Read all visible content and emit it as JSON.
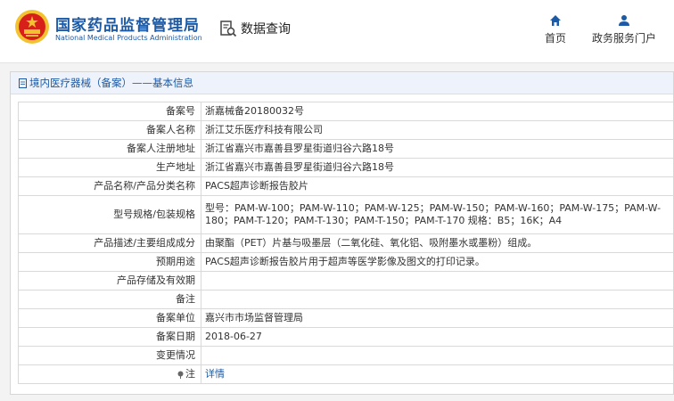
{
  "header": {
    "brand_cn": "国家药品监督管理局",
    "brand_en": "National Medical Products Administration",
    "query_label": "数据查询",
    "nav": [
      {
        "label": "首页",
        "icon": "home-icon"
      },
      {
        "label": "政务服务门户",
        "icon": "user-icon"
      }
    ]
  },
  "breadcrumb": "境内医疗器械（备案）——基本信息",
  "rows": [
    {
      "label": "备案号",
      "value": "浙嘉械备20180032号"
    },
    {
      "label": "备案人名称",
      "value": "浙江艾乐医疗科技有限公司"
    },
    {
      "label": "备案人注册地址",
      "value": "浙江省嘉兴市嘉善县罗星街道归谷六路18号"
    },
    {
      "label": "生产地址",
      "value": "浙江省嘉兴市嘉善县罗星街道归谷六路18号"
    },
    {
      "label": "产品名称/产品分类名称",
      "value": "PACS超声诊断报告胶片"
    },
    {
      "label": "型号规格/包装规格",
      "value": "型号：PAM-W-100；PAM-W-110；PAM-W-125；PAM-W-150；PAM-W-160；PAM-W-175；PAM-W-180；PAM-T-120；PAM-T-130；PAM-T-150；PAM-T-170 规格：B5；16K；A4"
    },
    {
      "label": "产品描述/主要组成成分",
      "value": "由聚酯（PET）片基与吸墨层（二氧化硅、氧化铝、吸附墨水或墨粉）组成。"
    },
    {
      "label": "预期用途",
      "value": "PACS超声诊断报告胶片用于超声等医学影像及图文的打印记录。"
    },
    {
      "label": "产品存储及有效期",
      "value": ""
    },
    {
      "label": "备注",
      "value": ""
    },
    {
      "label": "备案单位",
      "value": "嘉兴市市场监督管理局"
    },
    {
      "label": "备案日期",
      "value": "2018-06-27"
    },
    {
      "label": "变更情况",
      "value": ""
    },
    {
      "label": "注",
      "value": "详情"
    }
  ],
  "colors": {
    "brand": "#1c5aa6",
    "emblem_red": "#d7201a",
    "emblem_gold": "#f2c230"
  }
}
